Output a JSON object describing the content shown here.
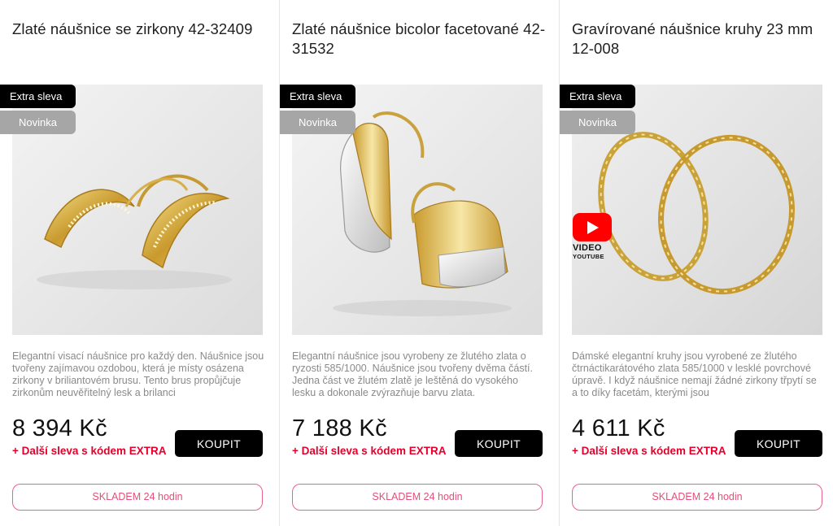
{
  "products": [
    {
      "title": "Zlaté náušnice se zirkony 42-32409",
      "badge_extra": "Extra sleva",
      "badge_new": "Novinka",
      "description": "Elegantní visací náušnice pro každý den. Náušnice jsou tvořeny zajímavou ozdobou, která je místy osázena zirkony v briliantovém brusu. Tento brus propůjčuje zirkonům neuvěřitelný lesk a brilanci",
      "price": "8 394 Kč",
      "promo": "+ Další sleva s kódem EXTRA",
      "buy_label": "KOUPIT",
      "stock_label": "SKLADEM 24 hodin"
    },
    {
      "title": "Zlaté náušnice bicolor facetované 42-31532",
      "badge_extra": "Extra sleva",
      "badge_new": "Novinka",
      "description": "Elegantní náušnice jsou vyrobeny ze žlutého zlata o ryzosti 585/1000. Náušnice jsou tvořeny dvěma částí. Jedna část ve žlutém zlatě je leštěná do vysokého lesku a dokonale zvýrazňuje barvu zlata.",
      "price": "7 188 Kč",
      "promo": "+ Další sleva s kódem EXTRA",
      "buy_label": "KOUPIT",
      "stock_label": "SKLADEM 24 hodin"
    },
    {
      "title": "Gravírované náušnice kruhy 23 mm 12-008",
      "badge_extra": "Extra sleva",
      "badge_new": "Novinka",
      "description": "Dámské elegantní kruhy jsou vyrobené ze žlutého čtrnáctikarátového zlata 585/1000 v lesklé povrchové úpravě. I když náušnice nemají žádné zirkony třpytí se a to díky facetám, kterými jsou",
      "price": "4 611 Kč",
      "promo": "+ Další sleva s kódem EXTRA",
      "buy_label": "KOUPIT",
      "stock_label": "SKLADEM 24 hodin",
      "video_label": "VIDEO",
      "video_source": "YOUTUBE"
    }
  ],
  "colors": {
    "accent_red": "#e4002b",
    "stock_border": "#e8648a",
    "badge_extra": "#000000",
    "badge_new": "#a6a6a6"
  },
  "icons": {
    "video": "youtube-play-icon"
  }
}
